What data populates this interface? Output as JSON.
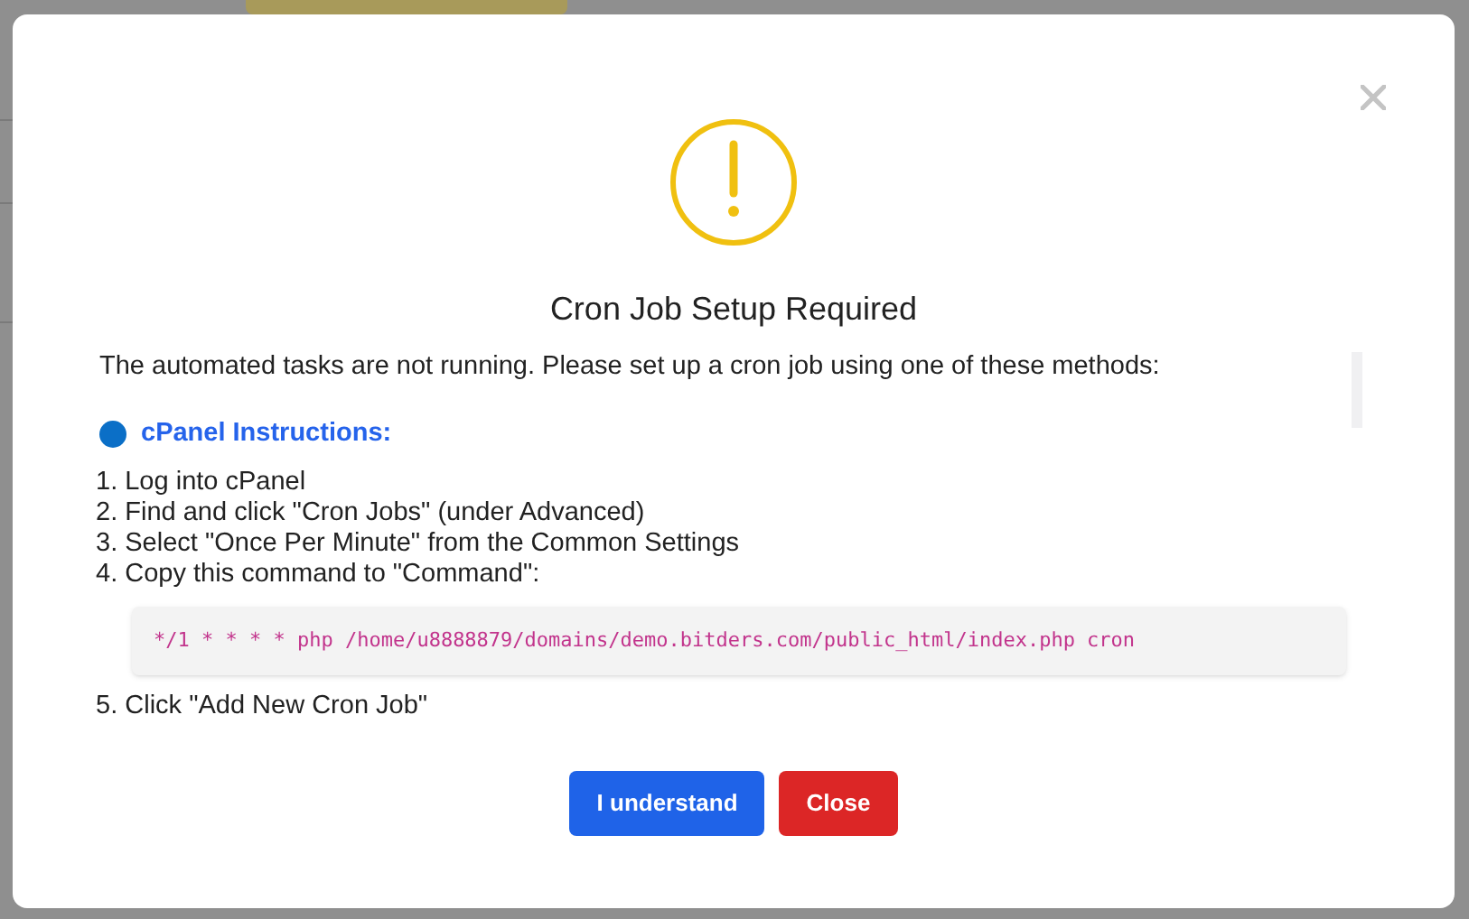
{
  "modal": {
    "title": "Cron Job Setup Required",
    "intro": "The automated tasks are not running. Please set up a cron job using one of these methods:",
    "section": {
      "heading": "cPanel Instructions:",
      "color": "#0b6fc7"
    },
    "steps": [
      "1. Log into cPanel",
      "2. Find and click \"Cron Jobs\" (under Advanced)",
      "3. Select \"Once Per Minute\" from the Common Settings",
      "4. Copy this command to \"Command\":"
    ],
    "command": "*/1 * * * * php /home/u8888879/domains/demo.bitders.com/public_html/index.php cron",
    "more_steps": [
      "5. Click \"Add New Cron Job\""
    ],
    "buttons": [
      {
        "label": "I understand",
        "kind": "primary"
      },
      {
        "label": "Close",
        "kind": "danger"
      }
    ]
  }
}
